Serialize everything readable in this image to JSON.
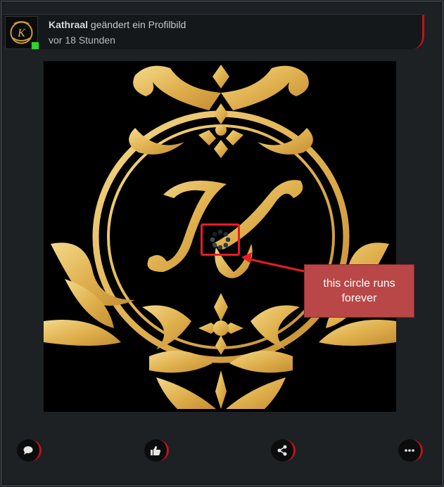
{
  "post": {
    "author": "Kathraal",
    "action_text": "geändert ein Profilbild",
    "time": "vor 18 Stunden"
  },
  "annotation": {
    "callout_text": "this circle runs forever",
    "box_color": "#ea1c24",
    "callout_color": "#b94747"
  },
  "image": {
    "logo_letter": "K",
    "gold": "#e2b556",
    "background": "#000000"
  },
  "actions": [
    {
      "icon": "comment-icon"
    },
    {
      "icon": "like-icon"
    },
    {
      "icon": "share-icon"
    },
    {
      "icon": "more-icon"
    }
  ],
  "colors": {
    "accent": "#c0141b",
    "online": "#2fd12f"
  }
}
